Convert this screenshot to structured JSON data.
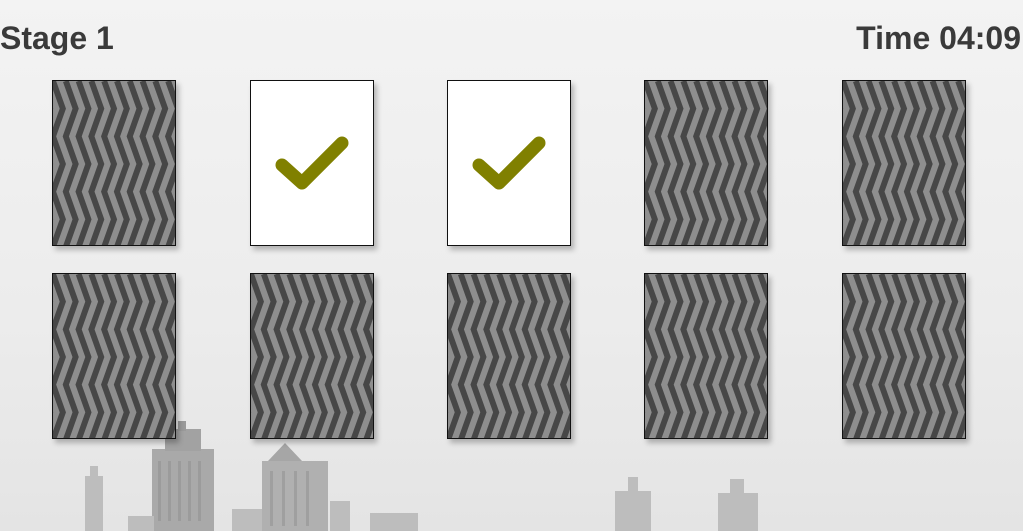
{
  "hud": {
    "stage_label": "Stage 1",
    "timer_label": "Time 04:09"
  },
  "colors": {
    "check": "#808000",
    "card_dark": "#474747",
    "card_light": "#8e8e8e"
  },
  "cards": [
    {
      "state": "face-down",
      "icon": "stripe-pattern"
    },
    {
      "state": "matched",
      "icon": "checkmark-icon"
    },
    {
      "state": "matched",
      "icon": "checkmark-icon"
    },
    {
      "state": "face-down",
      "icon": "stripe-pattern"
    },
    {
      "state": "face-down",
      "icon": "stripe-pattern"
    },
    {
      "state": "face-down",
      "icon": "stripe-pattern"
    },
    {
      "state": "face-down",
      "icon": "stripe-pattern"
    },
    {
      "state": "face-down",
      "icon": "stripe-pattern"
    },
    {
      "state": "face-down",
      "icon": "stripe-pattern"
    },
    {
      "state": "face-down",
      "icon": "stripe-pattern"
    }
  ]
}
